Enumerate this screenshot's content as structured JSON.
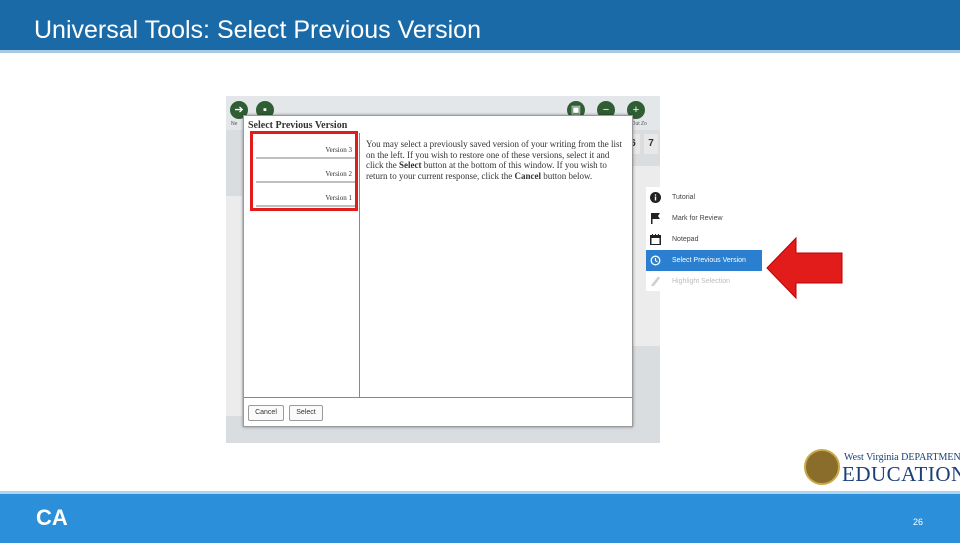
{
  "slide": {
    "title": "Universal Tools: Select Previous Version",
    "page_number": "26",
    "footer_logo": "CA",
    "partner_logo": {
      "line1": "West Virginia DEPARTMENT OF",
      "line2": "EDUCATION"
    }
  },
  "dialog": {
    "title": "Select Previous Version",
    "versions": [
      {
        "label": "Version 3"
      },
      {
        "label": "Version 2"
      },
      {
        "label": "Version 1"
      }
    ],
    "instructions": {
      "p1": "You may select a previously saved version of your writing from the list on the left. If you wish to restore one of these versions, select it and click the ",
      "select_word": "Select",
      "p2": " button at the bottom of this window. If you wish to return to your current response, click the ",
      "cancel_word": "Cancel",
      "p3": " button below."
    },
    "buttons": {
      "cancel": "Cancel",
      "select": "Select"
    }
  },
  "background": {
    "numbers": [
      "6",
      "7"
    ],
    "tool_labels": {
      "left": "Ne",
      "right": "m Out  Zo"
    }
  },
  "context_menu": {
    "items": [
      {
        "label": "Tutorial",
        "icon": "info-icon",
        "state": "normal"
      },
      {
        "label": "Mark for Review",
        "icon": "flag-icon",
        "state": "normal"
      },
      {
        "label": "Notepad",
        "icon": "notepad-icon",
        "state": "normal"
      },
      {
        "label": "Select Previous Version",
        "icon": "history-icon",
        "state": "active"
      },
      {
        "label": "Highlight Selection",
        "icon": "highlighter-icon",
        "state": "disabled"
      }
    ]
  },
  "colors": {
    "header_blue": "#1a6aa8",
    "footer_blue": "#2b90d9",
    "highlight_red": "#e21b1b",
    "menu_active": "#2a7fd0"
  }
}
